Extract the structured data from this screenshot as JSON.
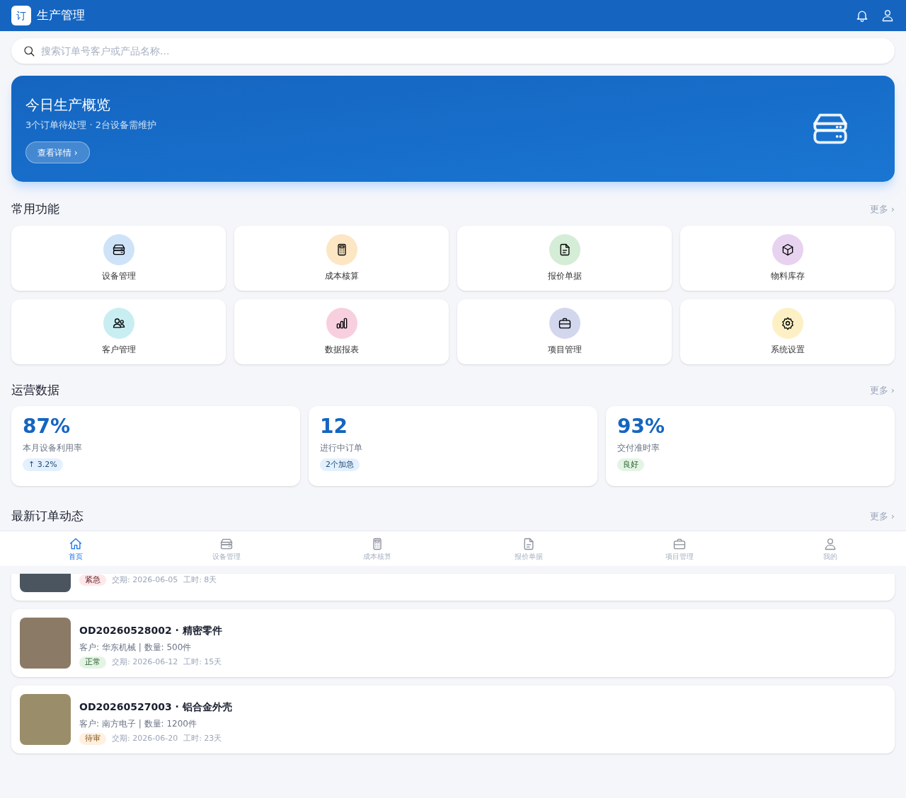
{
  "app_bar": {
    "logo": "订",
    "title": "生产管理"
  },
  "search": {
    "placeholder": "搜索订单号客户或产品名称..."
  },
  "banner": {
    "title": "今日生产概览",
    "subtitle": "3个订单待处理 · 2台设备需维护",
    "button": "查看详情 ›"
  },
  "quick_actions": {
    "title": "常用功能",
    "more": "更多 ›",
    "items": [
      {
        "label": "设备管理",
        "color": "#cfe3f8"
      },
      {
        "label": "成本核算",
        "color": "#fde6c4"
      },
      {
        "label": "报价单据",
        "color": "#d5ecd7"
      },
      {
        "label": "物料库存",
        "color": "#e7d3ef"
      },
      {
        "label": "客户管理",
        "color": "#c8eef2"
      },
      {
        "label": "数据报表",
        "color": "#f8cfdf"
      },
      {
        "label": "项目管理",
        "color": "#d3d7ee"
      },
      {
        "label": "系统设置",
        "color": "#fdf0c4"
      }
    ]
  },
  "stats": {
    "title": "运营数据",
    "more": "更多 ›",
    "items": [
      {
        "value": "87%",
        "label": "本月设备利用率",
        "badge": "↑ 3.2%",
        "color": "#e3f0fd"
      },
      {
        "value": "12",
        "label": "进行中订单",
        "badge": "2个加急",
        "color": "#e3f0fd"
      },
      {
        "value": "93%",
        "label": "交付准时率",
        "badge": "良好",
        "color": "#e3f4e4"
      }
    ]
  },
  "orders": {
    "title": "最新订单动态",
    "more": "更多 ›",
    "items": [
      {
        "tag": "紧急",
        "color": "#fde8ea",
        "due": "交期: 2026-06-05",
        "duration": "工时: 8天"
      },
      {
        "title": "OD20260528002 · 精密零件",
        "detail": "客户: 华东机械 | 数量: 500件",
        "tag": "正常",
        "color": "#e3f4e4",
        "due": "交期: 2026-06-12",
        "duration": "工时: 15天"
      },
      {
        "title": "OD20260527003 · 铝合金外壳",
        "detail": "客户: 南方电子 | 数量: 1200件",
        "tag": "待审",
        "color": "#fff0df",
        "due": "交期: 2026-06-20",
        "duration": "工时: 23天"
      }
    ]
  },
  "bottom_nav": [
    {
      "label": "首页",
      "selected": true
    },
    {
      "label": "设备管理",
      "selected": false
    },
    {
      "label": "成本核算",
      "selected": false
    },
    {
      "label": "报价单据",
      "selected": false
    },
    {
      "label": "项目管理",
      "selected": false
    },
    {
      "label": "我的",
      "selected": false
    }
  ]
}
